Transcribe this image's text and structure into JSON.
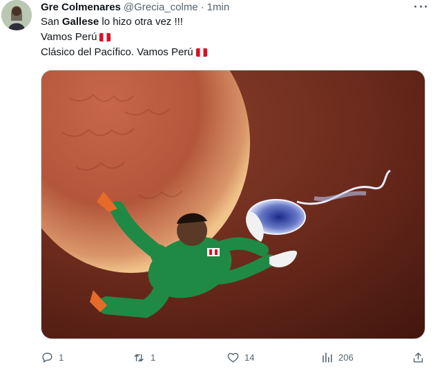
{
  "tweet": {
    "author_name": "Gre Colmenares",
    "handle": "@Grecia_colme",
    "separator": "·",
    "time": "1min",
    "lines": {
      "line1_prefix": "San ",
      "line1_bold": "Gallese",
      "line1_suffix": " lo hizo otra vez !!!",
      "line2": "Vamos Perú",
      "line3": "Clásico del Pacífico. Vamos Perú"
    },
    "flag_emoji": "peru-flag-icon"
  },
  "actions": {
    "reply_count": "1",
    "retweet_count": "1",
    "like_count": "14",
    "views_count": "206"
  },
  "icons": {
    "avatar": "avatar",
    "more": "more-icon",
    "reply": "reply-icon",
    "retweet": "retweet-icon",
    "like": "like-icon",
    "views": "views-icon",
    "share": "share-icon"
  },
  "colors": {
    "text": "#0f1419",
    "secondary": "#536471",
    "flag_red": "#d91023",
    "egg": "#b5654a",
    "jersey": "#1f8a45"
  }
}
